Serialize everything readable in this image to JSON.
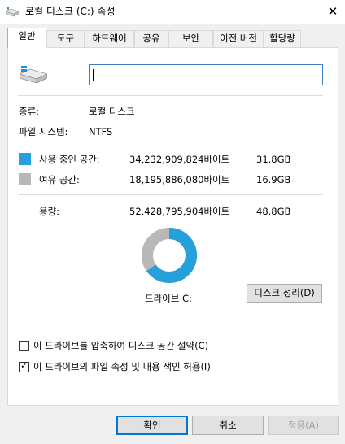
{
  "window": {
    "title": "로컬 디스크 (C:) 속성",
    "close_glyph": "✕"
  },
  "tabs": [
    {
      "label": "일반",
      "active": true
    },
    {
      "label": "도구"
    },
    {
      "label": "하드웨어"
    },
    {
      "label": "공유"
    },
    {
      "label": "보안"
    },
    {
      "label": "이전 버전"
    },
    {
      "label": "할당량"
    }
  ],
  "general": {
    "name_value": "",
    "type_label": "종류:",
    "type_value": "로컬 디스크",
    "fs_label": "파일 시스템:",
    "fs_value": "NTFS",
    "used": {
      "label": "사용 중인 공간:",
      "bytes": "34,232,909,824바이트",
      "size": "31.8GB",
      "color": "#26a0da"
    },
    "free": {
      "label": "여유 공간:",
      "bytes": "18,195,886,080바이트",
      "size": "16.9GB",
      "color": "#b8b8b8"
    },
    "capacity": {
      "label": "용량:",
      "bytes": "52,428,795,904바이트",
      "size": "48.8GB"
    },
    "used_fraction": 0.653,
    "drive_label": "드라이브 C:",
    "cleanup_button": "디스크 정리(D)",
    "compress_checkbox": {
      "label": "이 드라이브를 압축하여 디스크 공간 절약(C)",
      "checked": false
    },
    "index_checkbox": {
      "label": "이 드라이브의 파일 속성 및 내용 색인 허용(I)",
      "checked": true
    }
  },
  "buttons": {
    "ok": "확인",
    "cancel": "취소",
    "apply": "적용(A)"
  }
}
